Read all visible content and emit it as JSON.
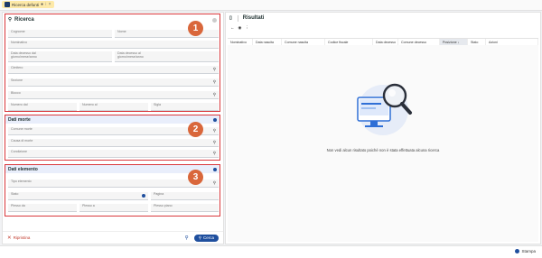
{
  "tab": {
    "title": "Ricerca defunti",
    "dot": "●",
    "close": "×"
  },
  "left": {
    "search_section": {
      "title": "Ricerca",
      "fields": {
        "cognome": "Cognome",
        "nome": "Nome",
        "nominativo": "Nominativo",
        "data_decesso_dal": "Data decesso dal\ngiorno/mese/anno",
        "data_decesso_al": "Data decesso al\ngiorno/mese/anno",
        "cimitero": "Cimitero",
        "sezione": "Sezione",
        "blocco": "Blocco",
        "numero_dal": "Numero dal",
        "numero_al": "Numero al",
        "sigla": "Sigla"
      }
    },
    "death_section": {
      "title": "Dati morte",
      "fields": {
        "comune_morte": "Comune morte",
        "causa_morte": "Causa di morte",
        "condizione": "Condizione"
      }
    },
    "element_section": {
      "title": "Dati elemento",
      "fields": {
        "tipo_elemento": "Tipo elemento",
        "stato": "Stato",
        "pagina": "Pagina",
        "plesso_da": "Plesso da",
        "plesso_a": "Plesso a",
        "plesso_piano": "Plesso piano"
      }
    },
    "footer": {
      "reset_label": "Ripristina",
      "search_label": "Cerca"
    }
  },
  "badges": [
    "1",
    "2",
    "3"
  ],
  "right": {
    "title": "Risultati",
    "columns": [
      "Nominativo",
      "Data nascita",
      "Comune nascita",
      "Codice fiscale",
      "Data decesso",
      "Comune decesso",
      "Posizione ↓",
      "Stato",
      "Azioni"
    ],
    "empty_message": "Non vedi alcun risultato poiché non è stata effettuata alcuna ricerca"
  },
  "bottom": {
    "print_label": "Stampa"
  },
  "colors": {
    "accent": "#1f4f9e",
    "highlight": "#d9383c",
    "badge": "#d9673b",
    "tab": "#fde9a8"
  }
}
